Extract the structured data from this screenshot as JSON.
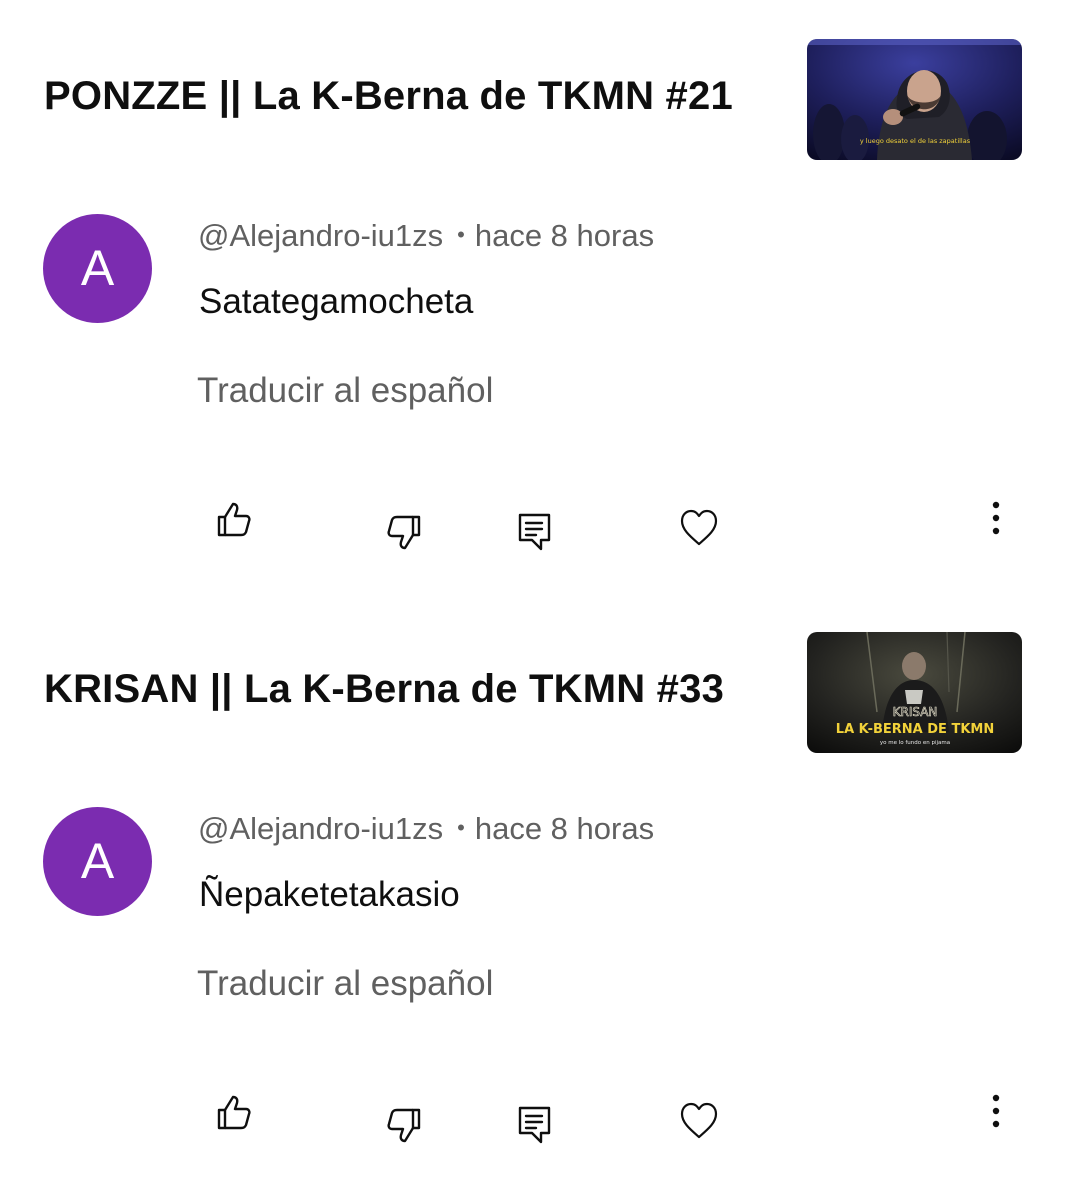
{
  "entries": [
    {
      "video_title": "PONZZE || La K-Berna de TKMN #21",
      "thumbnail": {
        "caption": "y luego desato el de las zapatillas"
      },
      "comment": {
        "avatar_letter": "A",
        "avatar_color": "#7b2cb0",
        "handle": "@Alejandro-iu1zs",
        "separator": "•",
        "time": "hace 8 horas",
        "text": "Satategamocheta",
        "translate_label": "Traducir al español"
      }
    },
    {
      "video_title": "KRISAN || La K-Berna de TKMN #33",
      "thumbnail": {
        "overlay_name": "KRISAN",
        "overlay_title": "LA K-BERNA DE TKMN",
        "caption": "yo me lo fundo en pijama"
      },
      "comment": {
        "avatar_letter": "A",
        "avatar_color": "#7b2cb0",
        "handle": "@Alejandro-iu1zs",
        "separator": "•",
        "time": "hace 8 horas",
        "text": "Ñepaketetakasio",
        "translate_label": "Traducir al español"
      }
    }
  ],
  "icons": {
    "like": "thumbs-up-icon",
    "dislike": "thumbs-down-icon",
    "reply": "comment-reply-icon",
    "heart": "heart-icon",
    "more": "more-vertical-icon"
  },
  "colors": {
    "text_primary": "#0f0f0f",
    "text_secondary": "#606060",
    "background": "#ffffff",
    "caption_yellow": "#f2d23a"
  }
}
